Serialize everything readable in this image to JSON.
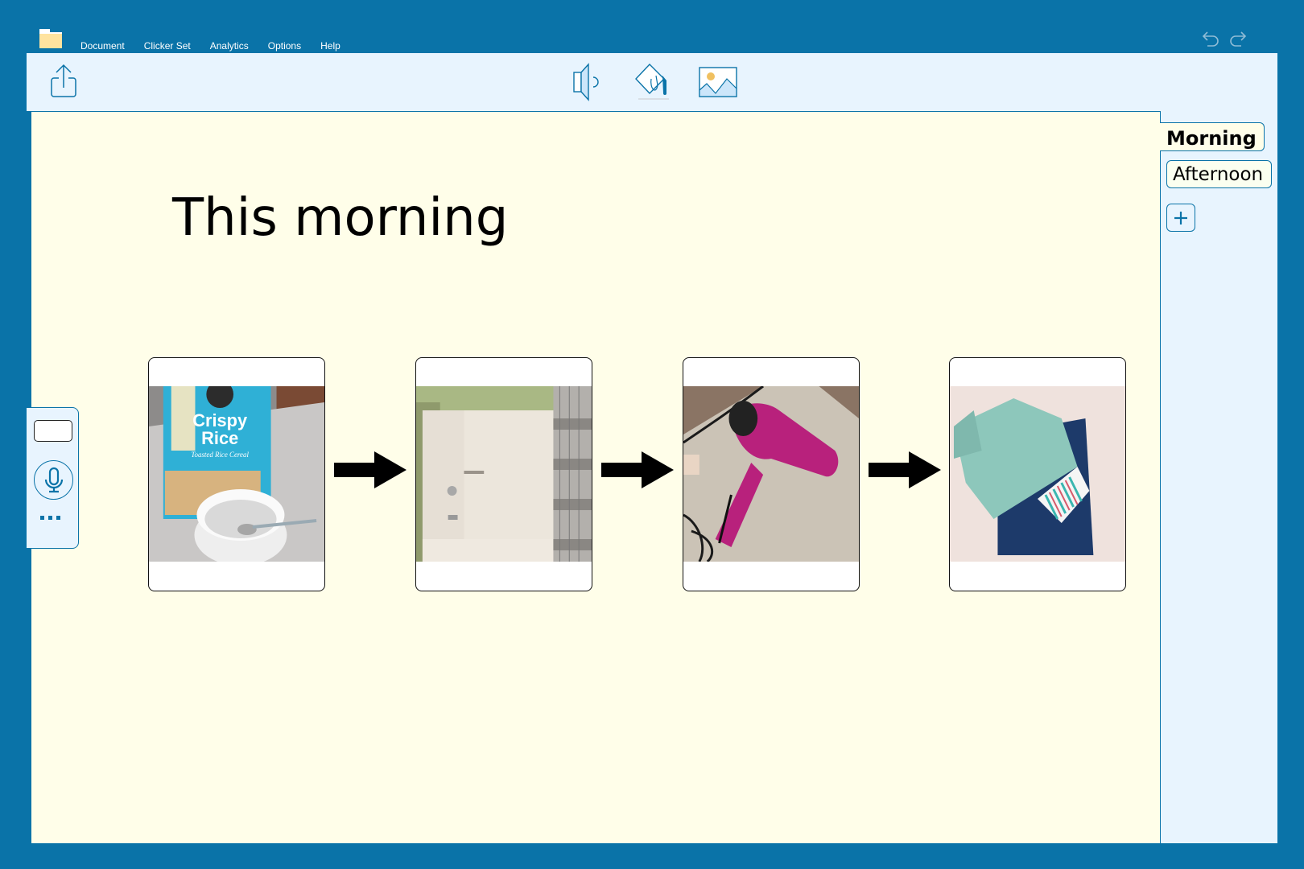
{
  "menu": {
    "items": [
      "Document",
      "Clicker Set",
      "Analytics",
      "Options",
      "Help"
    ]
  },
  "colors": {
    "window_bg": "#0a73a8",
    "toolbar_bg": "#e8f4fe",
    "canvas_bg": "#fffee9",
    "folder": "#ffe39f",
    "accent": "#0a73a8"
  },
  "toolbar": {
    "share_icon": "share-icon",
    "tools": [
      "speaker-icon",
      "paint-bucket-icon",
      "image-icon"
    ]
  },
  "page": {
    "title": "This morning"
  },
  "sequence": {
    "cards": [
      {
        "name": "breakfast",
        "description": "Crispy Rice cereal box and bowl with spoon"
      },
      {
        "name": "shower",
        "description": "Shower/bathtub with curtain"
      },
      {
        "name": "hair-dryer",
        "description": "Pink hair dryer on counter"
      },
      {
        "name": "get-dressed",
        "description": "Folded clothes on bed"
      }
    ]
  },
  "side_panel": {
    "more_label": "..."
  },
  "tabs": {
    "items": [
      "Morning",
      "Afternoon"
    ],
    "active": "Morning",
    "add_label": "+"
  }
}
